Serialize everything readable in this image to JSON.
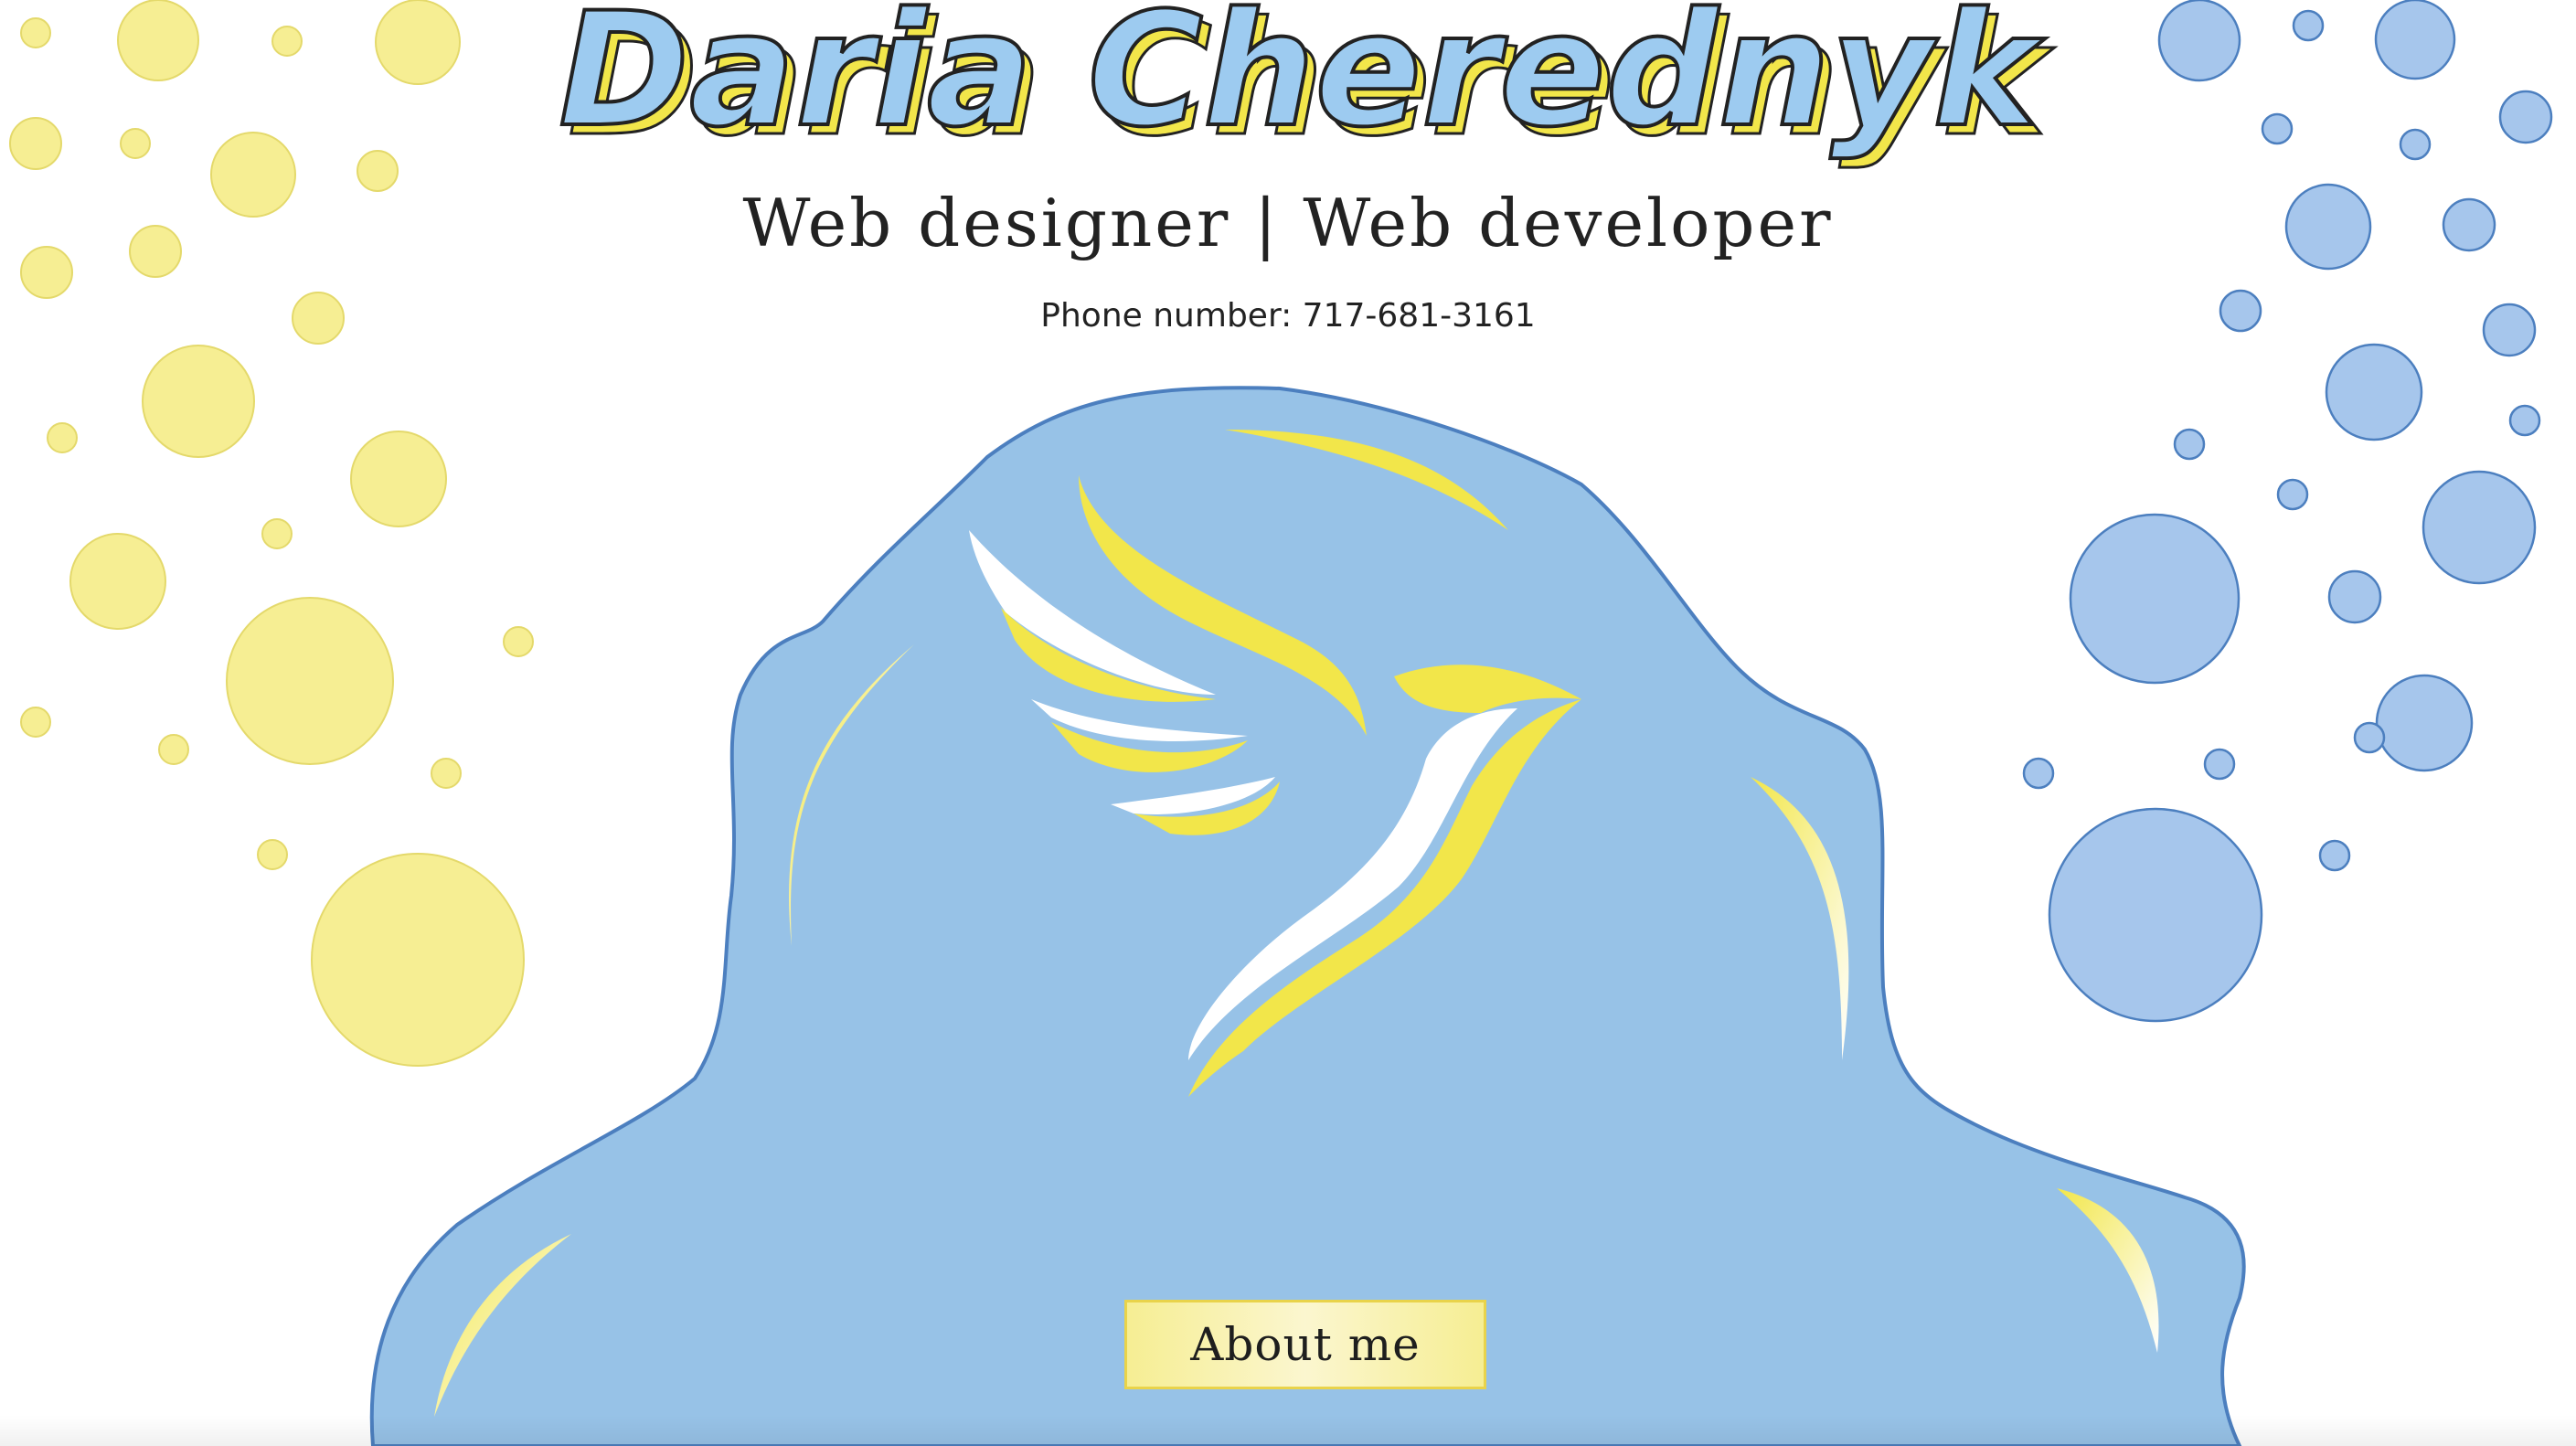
{
  "header": {
    "title": "Daria Cherednyk",
    "subtitle": "Web designer | Web developer",
    "phone": "Phone number: 717-681-3161"
  },
  "hero": {
    "about_button_label": "About me"
  },
  "colors": {
    "yellow": "#f6ee93",
    "blue": "#97c2e7",
    "blue_outline": "#4c7fbf",
    "title_fill": "#9dcbf0",
    "title_shadow": "#f2e64a"
  }
}
